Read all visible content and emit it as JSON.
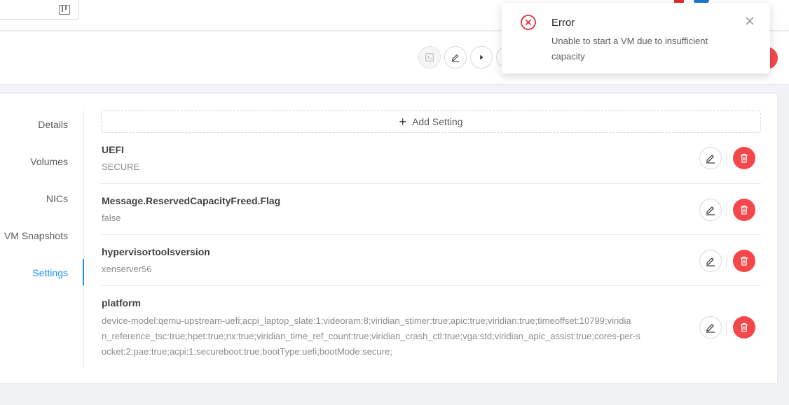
{
  "notification": {
    "title": "Error",
    "description": "Unable to start a VM due to insufficient capacity"
  },
  "tabs": [
    {
      "label": "Details"
    },
    {
      "label": "Volumes"
    },
    {
      "label": "NICs"
    },
    {
      "label": "VM Snapshots"
    },
    {
      "label": "Settings",
      "active": true
    }
  ],
  "add_setting_label": "Add Setting",
  "settings": [
    {
      "name": "UEFI",
      "value": "SECURE"
    },
    {
      "name": "Message.ReservedCapacityFreed.Flag",
      "value": "false"
    },
    {
      "name": "hypervisortoolsversion",
      "value": "xenserver56"
    },
    {
      "name": "platform",
      "value_lines": [
        "device-model:qemu-upstream-uefi;acpi_laptop_slate:1;videoram:8;viridian_stimer:true;apic:true;viridian:true;timeoffset:10799;viridia",
        "n_reference_tsc:true;hpet:true;nx:true;viridian_time_ref_count:true;viridian_crash_ctl:true;vga:std;viridian_apic_assist:true;cores-per-s",
        "ocket:2;pae:true;acpi:1;secureboot:true;bootType:uefi;bootMode:secure;"
      ]
    }
  ],
  "colors": {
    "accent": "#1890ff",
    "danger": "#f5474a",
    "error_icon": "#e0303a"
  }
}
